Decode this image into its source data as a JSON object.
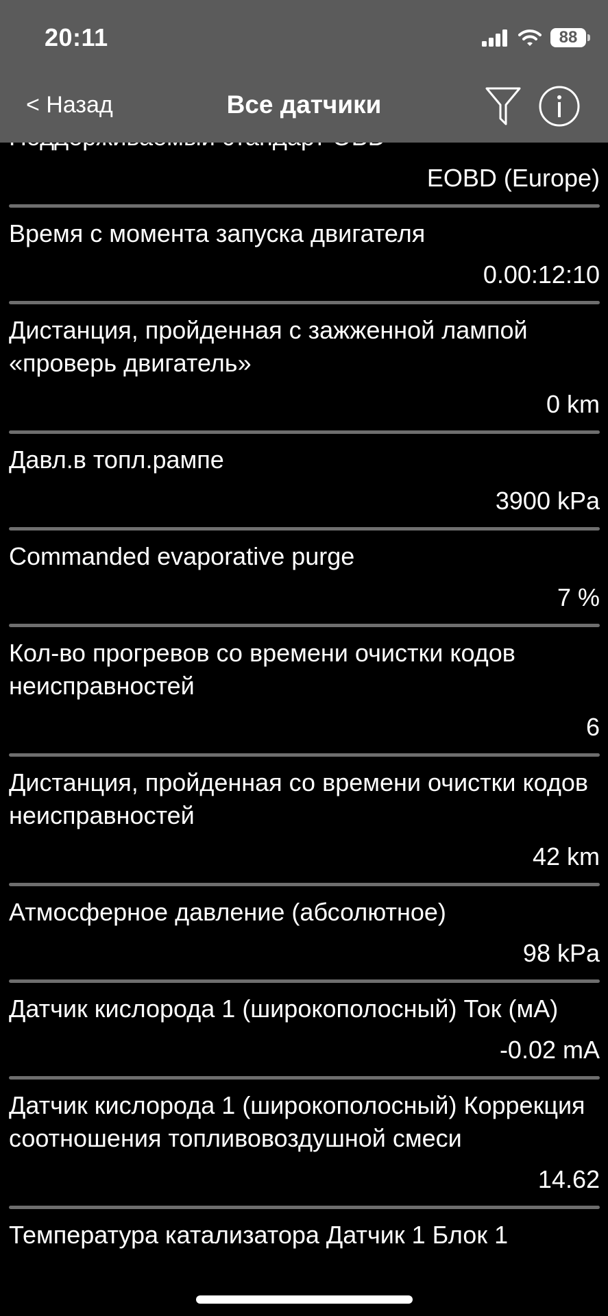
{
  "status": {
    "time": "20:11",
    "battery": "88"
  },
  "nav": {
    "back_label": "< Назад",
    "title": "Все датчики"
  },
  "rows": [
    {
      "label": "Поддерживаемый стандарт OBD",
      "value": "EOBD (Europe)"
    },
    {
      "label": "Время с момента запуска двигателя",
      "value": "0.00:12:10"
    },
    {
      "label": "Дистанция, пройденная с зажженной лампой «проверь двигатель»",
      "value": "0 km"
    },
    {
      "label": "Давл.в топл.рампе",
      "value": "3900 kPa"
    },
    {
      "label": "Commanded evaporative purge",
      "value": "7 %"
    },
    {
      "label": "Кол-во прогревов со времени очистки кодов неисправностей",
      "value": "6"
    },
    {
      "label": "Дистанция, пройденная со времени очистки кодов неисправностей",
      "value": "42 km"
    },
    {
      "label": "Атмосферное давление (абсолютное)",
      "value": "98 kPa"
    },
    {
      "label": "Датчик кислорода 1 (широкополосный) Ток (мА)",
      "value": "-0.02 mA"
    },
    {
      "label": "Датчик кислорода 1 (широкополосный) Коррекция соотношения топливовоздушной смеси",
      "value": "14.62"
    },
    {
      "label": "Температура катализатора Датчик 1 Блок 1",
      "value": ""
    }
  ],
  "icons": {
    "filter": "filter-icon",
    "info": "info-icon"
  }
}
